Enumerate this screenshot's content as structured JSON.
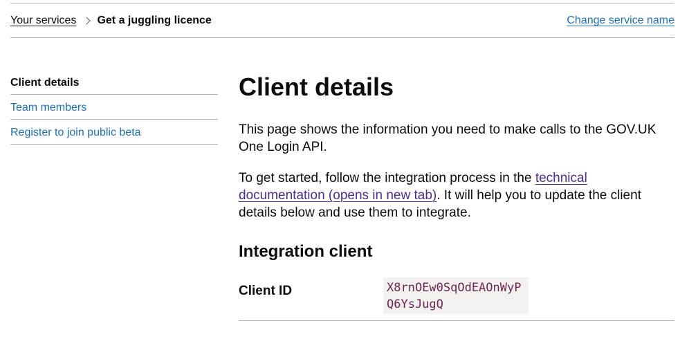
{
  "breadcrumbs": {
    "items": [
      "Your services"
    ],
    "current": "Get a juggling licence"
  },
  "header": {
    "change_service_name": "Change service name"
  },
  "sidenav": {
    "items": [
      {
        "label": "Client details",
        "active": true
      },
      {
        "label": "Team members",
        "active": false
      },
      {
        "label": "Register to join public beta",
        "active": false
      }
    ]
  },
  "main": {
    "title": "Client details",
    "intro": "This page shows the information you need to make calls to the GOV.UK One Login API.",
    "p2_before": "To get started, follow the integration process in the ",
    "p2_link": "technical documentation (opens in new tab)",
    "p2_after": ". It will help you to update the client details below and use them to integrate.",
    "section_heading": "Integration client",
    "rows": [
      {
        "key": "Client ID",
        "value": "X8rnOEw0SqOdEAOnWyPQ6YsJugQ"
      }
    ]
  },
  "colors": {
    "link": "#1d70b8",
    "visited_link": "#4c2c92",
    "text": "#0b0c0c",
    "border": "#b1b4b6",
    "code_bg": "#f3f2f1",
    "code_text": "#70244f"
  }
}
